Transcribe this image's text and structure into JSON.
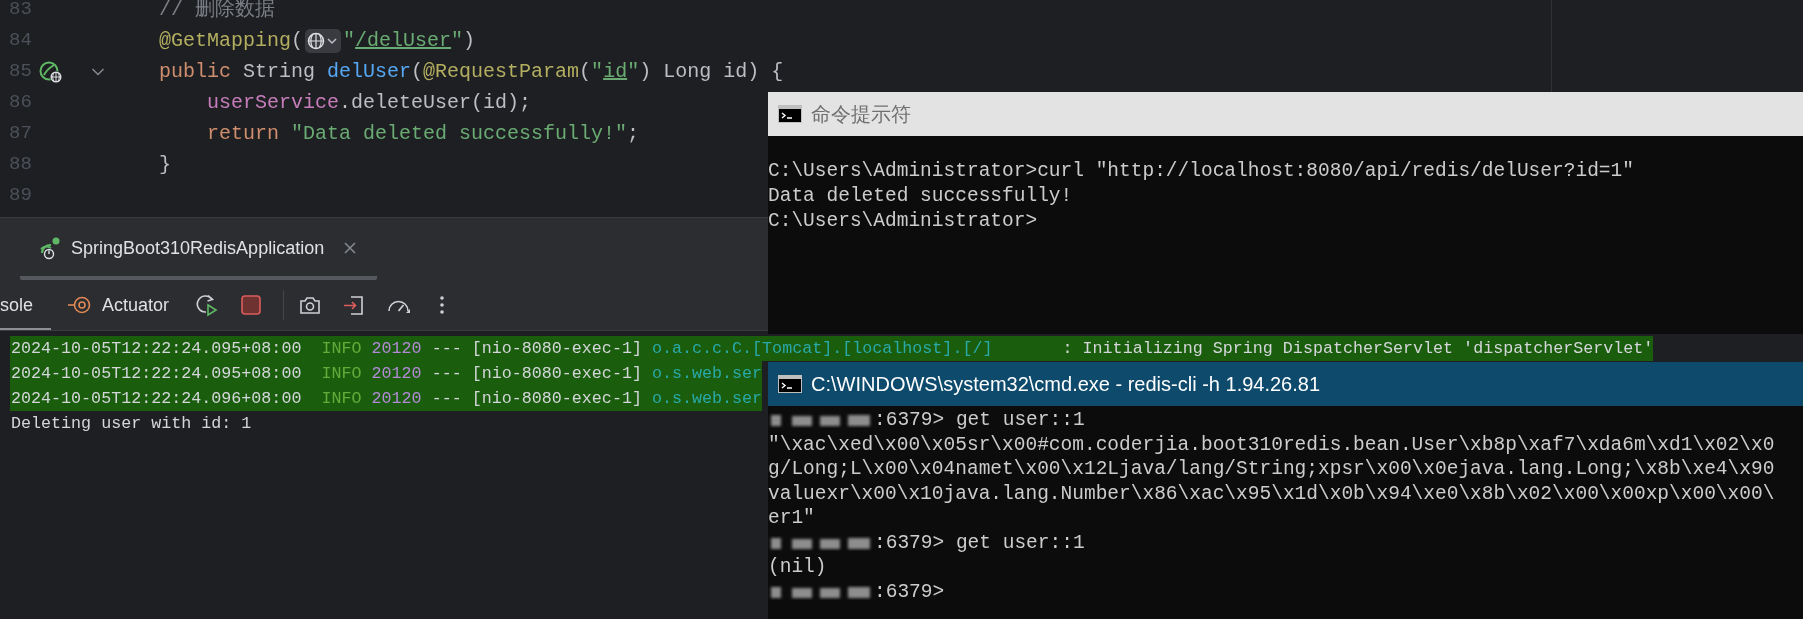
{
  "editor": {
    "lines": [
      {
        "number": "83",
        "run_marker": false,
        "foldable": false,
        "tokens": [
          {
            "kind": "comment",
            "text": "// 删除数据"
          }
        ]
      },
      {
        "number": "84",
        "run_marker": false,
        "foldable": false,
        "tokens": [
          {
            "kind": "annotation",
            "text": "@GetMapping"
          },
          {
            "kind": "plain",
            "text": "("
          },
          {
            "kind": "url-inlay"
          },
          {
            "kind": "string",
            "text": "\""
          },
          {
            "kind": "link",
            "text": "/delUser"
          },
          {
            "kind": "string",
            "text": "\""
          },
          {
            "kind": "plain",
            "text": ")"
          }
        ]
      },
      {
        "number": "85",
        "run_marker": true,
        "foldable": true,
        "tokens": [
          {
            "kind": "keyword",
            "text": "public "
          },
          {
            "kind": "plain",
            "text": "String "
          },
          {
            "kind": "method",
            "text": "delUser"
          },
          {
            "kind": "plain",
            "text": "("
          },
          {
            "kind": "annotation",
            "text": "@RequestParam"
          },
          {
            "kind": "plain",
            "text": "("
          },
          {
            "kind": "string",
            "text": "\""
          },
          {
            "kind": "link",
            "text": "id"
          },
          {
            "kind": "string",
            "text": "\""
          },
          {
            "kind": "plain",
            "text": ") Long id) {"
          }
        ]
      },
      {
        "number": "86",
        "run_marker": false,
        "foldable": false,
        "indented": true,
        "tokens": [
          {
            "kind": "field",
            "text": "userService"
          },
          {
            "kind": "plain",
            "text": ".deleteUser(id);"
          }
        ]
      },
      {
        "number": "87",
        "run_marker": false,
        "foldable": false,
        "indented": true,
        "tokens": [
          {
            "kind": "keyword",
            "text": "return "
          },
          {
            "kind": "string",
            "text": "\"Data deleted successfully!\""
          },
          {
            "kind": "plain",
            "text": ";"
          }
        ]
      },
      {
        "number": "88",
        "run_marker": false,
        "foldable": false,
        "tokens": [
          {
            "kind": "plain",
            "text": "}"
          }
        ]
      },
      {
        "number": "89",
        "run_marker": false,
        "foldable": false
      }
    ]
  },
  "run_panel": {
    "tabs": [
      {
        "label": "SpringBoot310RedisApplication",
        "selected": true
      }
    ],
    "tool_tabs": [
      {
        "kind": "console",
        "label": "sole",
        "selected": true
      },
      {
        "kind": "actuator",
        "label": "Actuator",
        "selected": false
      }
    ],
    "console": [
      {
        "kind": "log",
        "highlighted": true,
        "timestamp": "2024-10-05T12:22:24.095+08:00",
        "level": "INFO",
        "pid": "20120",
        "separator": "---",
        "thread": "[nio-8080-exec-1]",
        "logger": "o.a.c.c.C.[Tomcat].[localhost].[/]",
        "message": ": Initializing Spring DispatcherServlet 'dispatcherServlet'"
      },
      {
        "kind": "log",
        "highlighted": true,
        "timestamp": "2024-10-05T12:22:24.095+08:00",
        "level": "INFO",
        "pid": "20120",
        "separator": "---",
        "thread": "[nio-8080-exec-1]",
        "logger": "o.s.web.ser"
      },
      {
        "kind": "log",
        "highlighted": true,
        "timestamp": "2024-10-05T12:22:24.096+08:00",
        "level": "INFO",
        "pid": "20120",
        "separator": "---",
        "thread": "[nio-8080-exec-1]",
        "logger": "o.s.web.ser"
      },
      {
        "kind": "plain",
        "highlighted": false,
        "text": "Deleting user with id: 1"
      }
    ]
  },
  "windows": [
    {
      "kind": "cmd",
      "title": "命令提示符",
      "active": false,
      "lines": [
        {
          "redacted": false,
          "text": "C:\\Users\\Administrator>curl \"http://localhost:8080/api/redis/delUser?id=1\""
        },
        {
          "redacted": false,
          "text": "Data deleted successfully!"
        },
        {
          "redacted": false,
          "text": "C:\\Users\\Administrator>"
        }
      ]
    },
    {
      "kind": "cmd",
      "title": "C:\\WINDOWS\\system32\\cmd.exe - redis-cli  -h 1.94.26.81",
      "active": true,
      "lines": [
        {
          "redacted": true,
          "text": ":6379> get user::1"
        },
        {
          "redacted": false,
          "text": "\"\\xac\\xed\\x00\\x05sr\\x00#com.coderjia.boot310redis.bean.User\\xb8p\\xaf7\\xda6m\\xd1\\x02\\x0"
        },
        {
          "redacted": false,
          "text": "g/Long;L\\x00\\x04namet\\x00\\x12Ljava/lang/String;xpsr\\x00\\x0ejava.lang.Long;\\x8b\\xe4\\x90"
        },
        {
          "redacted": false,
          "text": "valuexr\\x00\\x10java.lang.Number\\x86\\xac\\x95\\x1d\\x0b\\x94\\xe0\\x8b\\x02\\x00\\x00xp\\x00\\x00\\"
        },
        {
          "redacted": false,
          "text": "er1\""
        },
        {
          "redacted": true,
          "text": ":6379> get user::1"
        },
        {
          "redacted": false,
          "text": "(nil)"
        },
        {
          "redacted": true,
          "text": ":6379>"
        }
      ]
    }
  ]
}
